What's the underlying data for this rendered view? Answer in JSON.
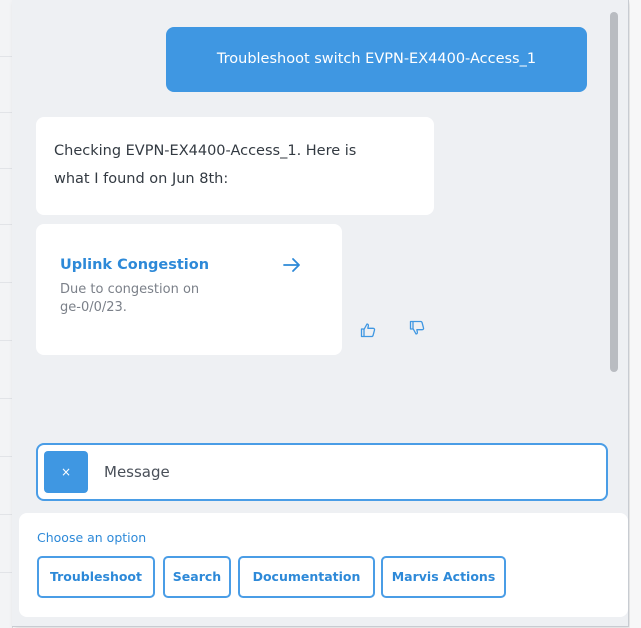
{
  "conversation": {
    "user_message": "Troubleshoot switch EVPN-EX4400-Access_1",
    "bot_message_line1": "Checking EVPN-EX4400-Access_1. Here is",
    "bot_message_line2": "what I found on Jun 8th:"
  },
  "result_card": {
    "title": "Uplink Congestion",
    "description_line1": "Due to congestion on",
    "description_line2": "ge-0/0/23.",
    "arrow_icon": "arrow-right-icon"
  },
  "feedback": {
    "thumbs_up_icon": "thumbs-up-icon",
    "thumbs_down_icon": "thumbs-down-icon"
  },
  "composer": {
    "clear_label": "×",
    "placeholder": "Message"
  },
  "options": {
    "label": "Choose an option",
    "buttons": [
      "Troubleshoot",
      "Search",
      "Documentation",
      "Marvis Actions"
    ]
  },
  "colors": {
    "accent": "#3f97e2",
    "link": "#2d89d8",
    "panel_bg": "#eef0f3",
    "text": "#333a42",
    "muted": "#7b8089"
  }
}
